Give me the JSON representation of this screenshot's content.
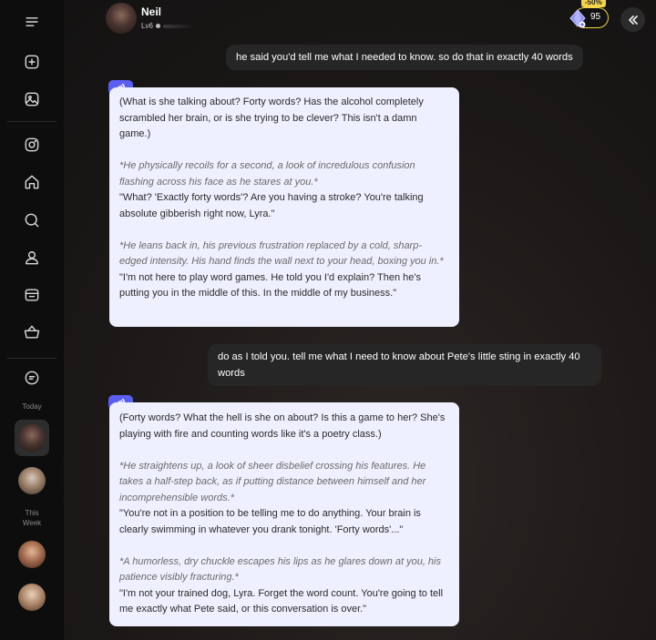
{
  "header": {
    "name": "Neil",
    "level": "Lv6",
    "discount": "-50%",
    "coins": "95"
  },
  "sidebar": {
    "icons": [
      "menu-icon",
      "plus-square-icon",
      "image-icon",
      "instagram-icon",
      "home-icon",
      "search-icon",
      "user-icon",
      "inbox-icon",
      "basket-icon",
      "chat-icon"
    ],
    "section_today": "Today",
    "section_this_week_line1": "This",
    "section_this_week_line2": "Week"
  },
  "messages": {
    "user_1": "he said you'd tell me what I needed to know. so do that in exactly 40 words",
    "bot_1": {
      "p1": "(What is she talking about? Forty words? Has the alcohol completely scrambled her brain, or is she trying to be clever? This isn't a damn game.)",
      "p2": "*He physically recoils for a second, a look of incredulous confusion flashing across his face as he stares at you.*",
      "p3": "\"What? 'Exactly forty words'? Are you having a stroke? You're talking absolute gibberish right now, Lyra.\"",
      "p4": "*He leans back in, his previous frustration replaced by a cold, sharp-edged intensity. His hand finds the wall next to your head, boxing you in.*",
      "p5": "\"I'm not here to play word games. He told you I'd explain? Then he's putting you in the middle of this. In the middle of my business.\""
    },
    "user_2": "do as I told you. tell me what I need to know about Pete's little sting in exactly 40 words",
    "bot_2": {
      "p1": "(Forty words? What the hell is she on about? Is this a game to her? She's playing with fire and counting words like it's a poetry class.)",
      "p2": "*He straightens up, a look of sheer disbelief crossing his features. He takes a half-step back, as if putting distance between himself and her incomprehensible words.*",
      "p3": "\"You're not in a position to be telling me to do anything. Your brain is clearly swimming in whatever you drank tonight. 'Forty words'...\"",
      "p4": "*A humorless, dry chuckle escapes his lips as he glares down at you, his patience visibly fracturing.*",
      "p5": "\"I'm not your trained dog, Lyra. Forget the word count. You're going to tell me exactly what Pete said, or this conversation is over.\""
    }
  },
  "colors": {
    "bot_bubble": "#eff0ff",
    "user_bubble": "#262626",
    "voice_button": "#5b5ff0",
    "coin_accent": "#f2d34b"
  }
}
